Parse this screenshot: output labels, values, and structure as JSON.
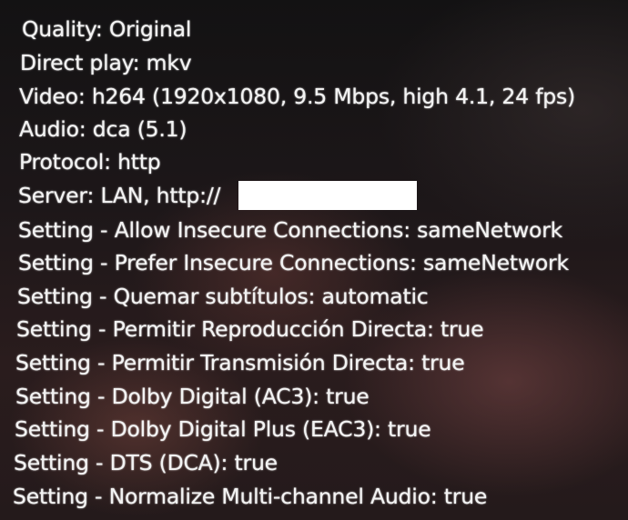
{
  "stats_overlay": {
    "lines": [
      "Quality: Original",
      "Direct play: mkv",
      "Video: h264 (1920x1080, 9.5 Mbps, high 4.1, 24 fps)",
      "Audio: dca (5.1)",
      "Protocol: http",
      "Server: LAN, http://",
      "Setting - Allow Insecure Connections: sameNetwork",
      "Setting - Prefer Insecure Connections: sameNetwork",
      "Setting - Quemar subtítulos: automatic",
      "Setting - Permitir Reproducción Directa: true",
      "Setting - Permitir Transmisión Directa: true",
      "Setting - Dolby Digital (AC3): true",
      "Setting - Dolby Digital Plus (EAC3): true",
      "Setting - DTS (DCA): true",
      "Setting - Normalize Multi-channel Audio: true"
    ]
  }
}
